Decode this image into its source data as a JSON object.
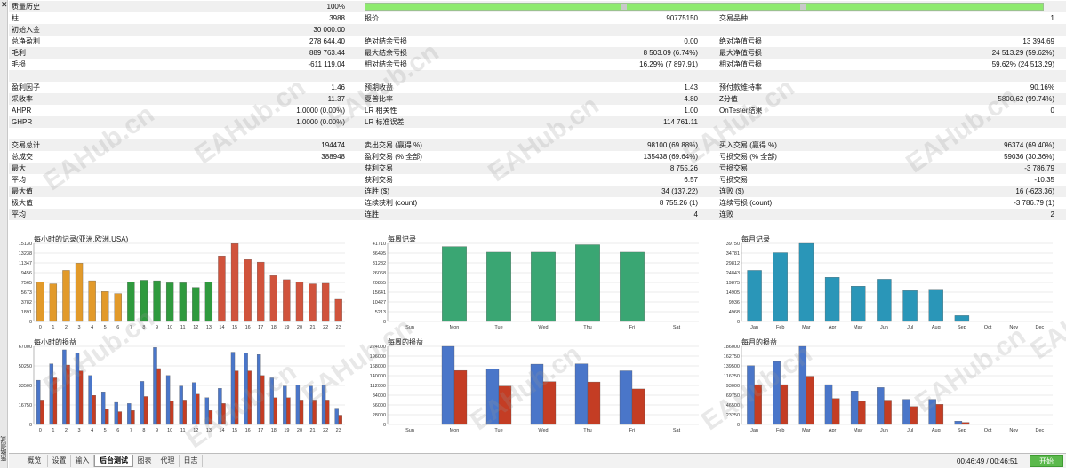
{
  "sidebar": {
    "close": "✕",
    "vertical_label": "策略测试"
  },
  "report": {
    "quality_label": "质量历史",
    "quality_value": "100%",
    "rows": [
      {
        "c1": "柱",
        "v1": "3988",
        "c2": "报价",
        "v2": "90775150",
        "c3": "交易品种",
        "v3": "1"
      },
      {
        "c1": "初始入金",
        "v1": "30 000.00",
        "c2": "",
        "v2": "",
        "c3": "",
        "v3": ""
      },
      {
        "c1": "总净盈利",
        "v1": "278 644.40",
        "c2": "绝对结余亏损",
        "v2": "0.00",
        "c3": "绝对净值亏损",
        "v3": "13 394.69"
      },
      {
        "c1": "毛利",
        "v1": "889 763.44",
        "c2": "最大结余亏损",
        "v2": "8 503.09 (6.74%)",
        "c3": "最大净值亏损",
        "v3": "24 513.29 (59.62%)"
      },
      {
        "c1": "毛损",
        "v1": "-611 119.04",
        "c2": "相对结余亏损",
        "v2": "16.29% (7 897.91)",
        "c3": "相对净值亏损",
        "v3": "59.62% (24 513.29)"
      },
      {
        "c1": "",
        "v1": "",
        "c2": "",
        "v2": "",
        "c3": "",
        "v3": ""
      },
      {
        "c1": "盈利因子",
        "v1": "1.46",
        "c2": "预期收益",
        "v2": "1.43",
        "c3": "预付款维持率",
        "v3": "90.16%"
      },
      {
        "c1": "采收率",
        "v1": "11.37",
        "c2": "夏普比率",
        "v2": "4.80",
        "c3": "Z分值",
        "v3": "5800.62 (99.74%)"
      },
      {
        "c1": "AHPR",
        "v1": "1.0000 (0.00%)",
        "c2": "LR 相关性",
        "v2": "1.00",
        "c3": "OnTester结果",
        "v3": "0"
      },
      {
        "c1": "GHPR",
        "v1": "1.0000 (0.00%)",
        "c2": "LR 标准误差",
        "v2": "114 761.11",
        "c3": "",
        "v3": ""
      },
      {
        "c1": "",
        "v1": "",
        "c2": "",
        "v2": "",
        "c3": "",
        "v3": ""
      },
      {
        "c1": "交易总计",
        "v1": "194474",
        "c2": "卖出交易 (赢得 %)",
        "v2": "98100 (69.88%)",
        "c3": "买入交易 (赢得 %)",
        "v3": "96374 (69.40%)"
      },
      {
        "c1": "总成交",
        "v1": "388948",
        "c2": "盈利交易 (% 全部)",
        "v2": "135438 (69.64%)",
        "c3": "亏损交易 (% 全部)",
        "v3": "59036 (30.36%)"
      },
      {
        "c1": "最大",
        "v1": "",
        "c2": "获利交易",
        "v2": "8 755.26",
        "c3": "亏损交易",
        "v3": "-3 786.79"
      },
      {
        "c1": "平均",
        "v1": "",
        "c2": "获利交易",
        "v2": "6.57",
        "c3": "亏损交易",
        "v3": "-10.35"
      },
      {
        "c1": "最大值",
        "v1": "",
        "c2": "连胜 ($)",
        "v2": "34 (137.22)",
        "c3": "连败 ($)",
        "v3": "16 (-623.36)"
      },
      {
        "c1": "极大值",
        "v1": "",
        "c2": "连续获利 (count)",
        "v2": "8 755.26 (1)",
        "c3": "连续亏损 (count)",
        "v3": "-3 786.79 (1)"
      },
      {
        "c1": "平均",
        "v1": "",
        "c2": "连胜",
        "v2": "4",
        "c3": "连败",
        "v3": "2"
      }
    ]
  },
  "colors": {
    "orange": "#e29a2a",
    "green": "#2f9a3e",
    "red": "#d0533c",
    "weekGreen": "#3aa673",
    "teal": "#2a96b8",
    "blue": "#4a76c9",
    "darkRed": "#c43d24",
    "gridline": "#d8d8d8",
    "progress": "#8eea6e"
  },
  "chart_data": [
    {
      "type": "bar",
      "title": "每小时的记录(亚洲,欧洲,USA)",
      "categories": [
        "0",
        "1",
        "2",
        "3",
        "4",
        "5",
        "6",
        "7",
        "8",
        "9",
        "10",
        "11",
        "12",
        "13",
        "14",
        "15",
        "16",
        "17",
        "18",
        "19",
        "20",
        "21",
        "22",
        "23"
      ],
      "yticks": [
        "0",
        "1891",
        "3782",
        "5673",
        "7565",
        "9456",
        "11347",
        "13238",
        "15130"
      ],
      "ylim": [
        0,
        15130
      ],
      "values": [
        7600,
        7300,
        9900,
        11300,
        7900,
        5800,
        5400,
        7700,
        8000,
        7900,
        7500,
        7500,
        6600,
        7600,
        12700,
        15100,
        12000,
        11500,
        8900,
        8100,
        7600,
        7300,
        7400,
        4300
      ],
      "series_colors": [
        "orange",
        "orange",
        "orange",
        "orange",
        "orange",
        "orange",
        "orange",
        "green",
        "green",
        "green",
        "green",
        "green",
        "green",
        "green",
        "red",
        "red",
        "red",
        "red",
        "red",
        "red",
        "red",
        "red",
        "red",
        "red"
      ]
    },
    {
      "type": "bar",
      "title": "每周记录",
      "categories": [
        "Sun",
        "Mon",
        "Tue",
        "Wed",
        "Thu",
        "Fri",
        "Sat"
      ],
      "yticks": [
        "0",
        "5213",
        "10427",
        "15641",
        "20855",
        "26068",
        "31282",
        "36495",
        "41710"
      ],
      "ylim": [
        0,
        41710
      ],
      "values": [
        0,
        40000,
        37000,
        37000,
        41000,
        37000,
        0
      ],
      "series_colors": [
        "weekGreen",
        "weekGreen",
        "weekGreen",
        "weekGreen",
        "weekGreen",
        "weekGreen",
        "weekGreen"
      ]
    },
    {
      "type": "bar",
      "title": "每月记录",
      "categories": [
        "Jan",
        "Feb",
        "Mar",
        "Apr",
        "May",
        "Jun",
        "Jul",
        "Aug",
        "Sep",
        "Oct",
        "Nov",
        "Dec"
      ],
      "yticks": [
        "0",
        "4968",
        "9936",
        "14905",
        "19875",
        "24843",
        "29812",
        "34781",
        "39750"
      ],
      "ylim": [
        0,
        39750
      ],
      "values": [
        26000,
        35000,
        39750,
        22500,
        18000,
        21500,
        15700,
        16400,
        3000,
        0,
        0,
        0
      ],
      "series_colors": [
        "teal",
        "teal",
        "teal",
        "teal",
        "teal",
        "teal",
        "teal",
        "teal",
        "teal",
        "teal",
        "teal",
        "teal"
      ]
    },
    {
      "type": "bar",
      "title": "每小时的损益",
      "categories": [
        "0",
        "1",
        "2",
        "3",
        "4",
        "5",
        "6",
        "7",
        "8",
        "9",
        "10",
        "11",
        "12",
        "13",
        "14",
        "15",
        "16",
        "17",
        "18",
        "19",
        "20",
        "21",
        "22",
        "23"
      ],
      "yticks": [
        "0",
        "16750",
        "33500",
        "50250",
        "67000"
      ],
      "ylim": [
        0,
        67000
      ],
      "series": [
        {
          "color": "blue",
          "values": [
            38000,
            52000,
            64000,
            61000,
            42000,
            28000,
            19000,
            18000,
            37000,
            66000,
            42000,
            33000,
            36000,
            23000,
            31000,
            62000,
            61000,
            60000,
            40000,
            33000,
            34000,
            33000,
            34000,
            14000
          ]
        },
        {
          "color": "darkRed",
          "values": [
            21000,
            40000,
            51000,
            46000,
            25000,
            13000,
            11000,
            12000,
            24000,
            48000,
            20000,
            21000,
            26000,
            12000,
            18000,
            46000,
            46000,
            42000,
            23000,
            23000,
            21000,
            21000,
            21000,
            8000
          ]
        }
      ]
    },
    {
      "type": "bar",
      "title": "每周的损益",
      "categories": [
        "Sun",
        "Mon",
        "Tue",
        "Wed",
        "Thu",
        "Fri",
        "Sat"
      ],
      "yticks": [
        "0",
        "28000",
        "56000",
        "84000",
        "112000",
        "140000",
        "168000",
        "196000",
        "224000"
      ],
      "ylim": [
        0,
        224000
      ],
      "series": [
        {
          "color": "blue",
          "values": [
            0,
            224000,
            160000,
            173000,
            174000,
            154000,
            0
          ]
        },
        {
          "color": "darkRed",
          "values": [
            0,
            155000,
            110000,
            123000,
            122000,
            102000,
            0
          ]
        }
      ]
    },
    {
      "type": "bar",
      "title": "每月的损益",
      "categories": [
        "Jan",
        "Feb",
        "Mar",
        "Apr",
        "May",
        "Jun",
        "Jul",
        "Aug",
        "Sep",
        "Oct",
        "Nov",
        "Dec"
      ],
      "yticks": [
        "0",
        "23250",
        "46500",
        "69750",
        "93000",
        "116250",
        "139500",
        "162750",
        "186000"
      ],
      "ylim": [
        0,
        186000
      ],
      "series": [
        {
          "color": "blue",
          "values": [
            140000,
            150000,
            186000,
            95000,
            80000,
            88000,
            60000,
            60000,
            8000,
            0,
            0,
            0
          ]
        },
        {
          "color": "darkRed",
          "values": [
            95000,
            95000,
            115000,
            62000,
            55000,
            58000,
            43000,
            48000,
            5000,
            0,
            0,
            0
          ]
        }
      ]
    }
  ],
  "tabs": [
    "概览",
    "设置",
    "输入",
    "后台测试",
    "图表",
    "代理",
    "日志"
  ],
  "active_tab": 3,
  "footer": {
    "time_elapsed": "00:46:49 / 00:46:51",
    "start_label": "开始"
  },
  "watermark_text": "EAHub.cn"
}
